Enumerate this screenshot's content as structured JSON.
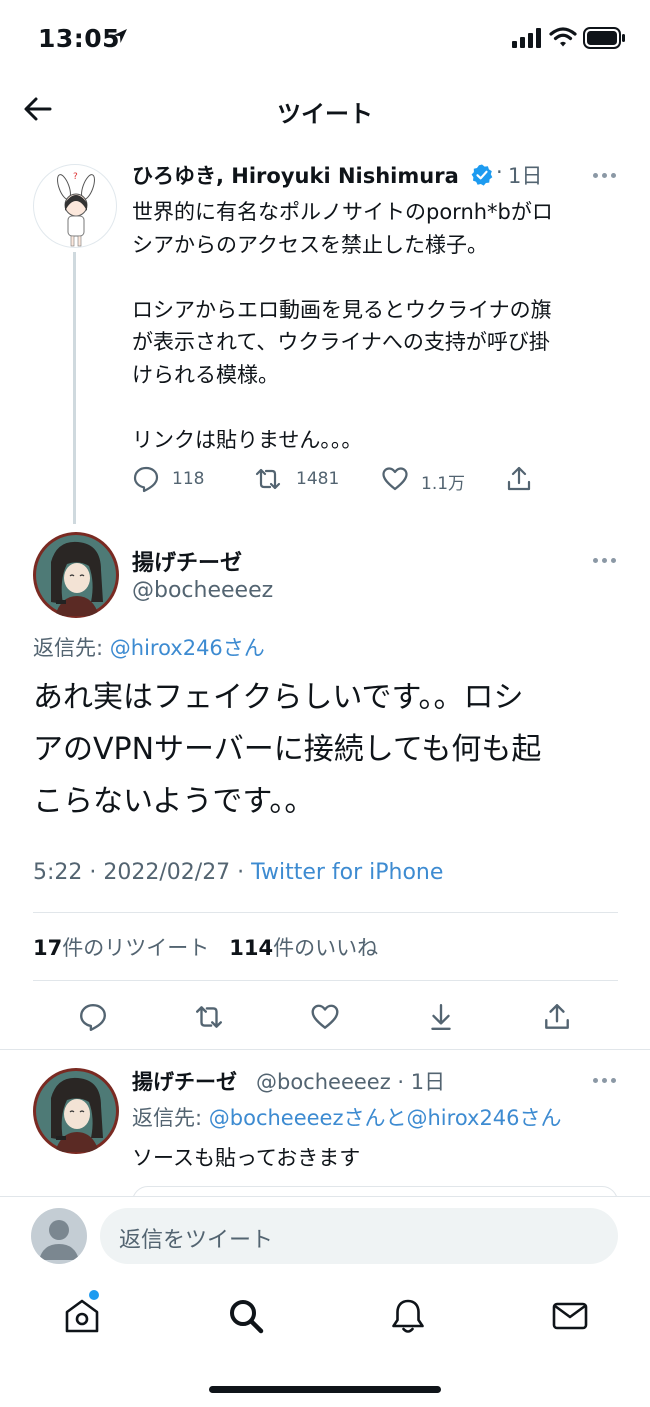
{
  "status_bar": {
    "time": "13:05"
  },
  "header": {
    "title": "ツイート"
  },
  "original_tweet": {
    "author_name": "ひろゆき, Hiroyuki Nishimura",
    "separator": "·",
    "time": "1日",
    "lines": [
      "世界的に有名なポルノサイトのpornh*bがロ",
      "シアからのアクセスを禁止した様子。",
      "",
      "ロシアからエロ動画を見るとウクライナの旗",
      "が表示されて、ウクライナへの支持が呼び掛",
      "けられる模様。",
      "",
      "リンクは貼りません。。。"
    ],
    "replies": "118",
    "retweets": "1481",
    "likes": "1.1万"
  },
  "main_tweet": {
    "author_name": "揚げチーゼ",
    "handle": "@bocheeeez",
    "reply_prefix": "返信先: ",
    "reply_target": "@hirox246さん",
    "lines": [
      "あれ実はフェイクらしいです。。ロシ",
      "アのVPNサーバーに接続しても何も起",
      "こらないようです。。"
    ],
    "timestamp": "5:22 · 2022/02/27 · ",
    "source": "Twitter for iPhone",
    "retweet_count": "17",
    "retweet_label": "件のリツイート",
    "like_count": "114",
    "like_label": "件のいいね"
  },
  "reply_tweet": {
    "author_name": "揚げチーゼ",
    "handle_time": "@bocheeeez · 1日",
    "reply_prefix": "返信先: ",
    "reply_target": "@bocheeeezさんと@hirox246さん",
    "text": "ソースも貼っておきます"
  },
  "compose": {
    "placeholder": "返信をツイート"
  },
  "colors": {
    "link": "#3d8bd1",
    "verified": "#1d9bf0",
    "secondary_text": "#536471"
  },
  "icons": [
    "location-arrow-icon",
    "signal-icon",
    "wifi-icon",
    "battery-icon",
    "back-arrow-icon",
    "verified-badge-icon",
    "more-icon",
    "reply-icon",
    "retweet-icon",
    "like-icon",
    "share-icon",
    "bookmark-icon",
    "home-icon",
    "search-icon",
    "notifications-icon",
    "messages-icon"
  ]
}
